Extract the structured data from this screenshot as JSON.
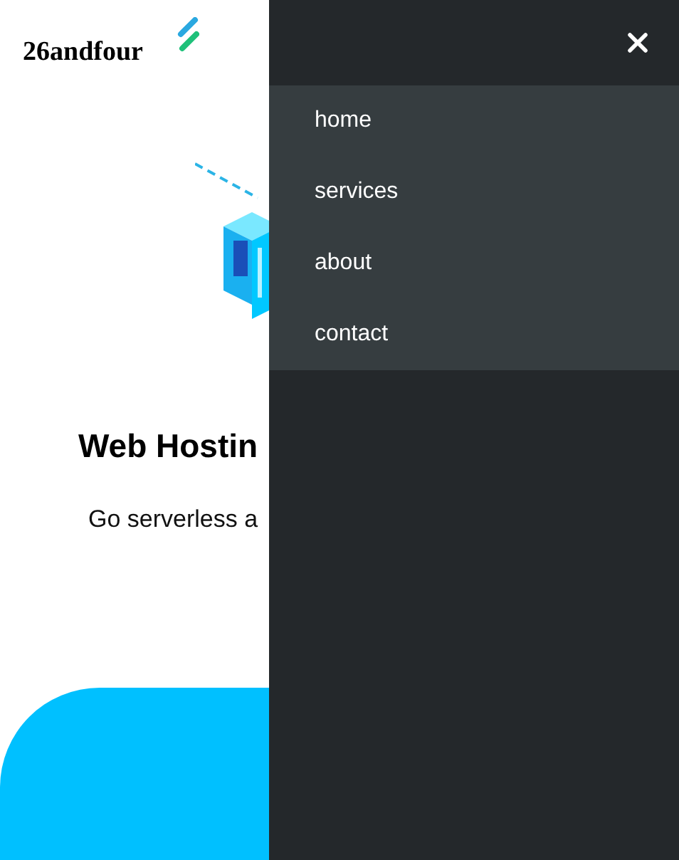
{
  "logo": {
    "text": "26andfour"
  },
  "hero": {
    "title": "Web Hostin",
    "subtitle": "Go serverless a"
  },
  "menu": {
    "items": [
      {
        "label": "home"
      },
      {
        "label": "services"
      },
      {
        "label": "about"
      },
      {
        "label": "contact"
      }
    ]
  }
}
